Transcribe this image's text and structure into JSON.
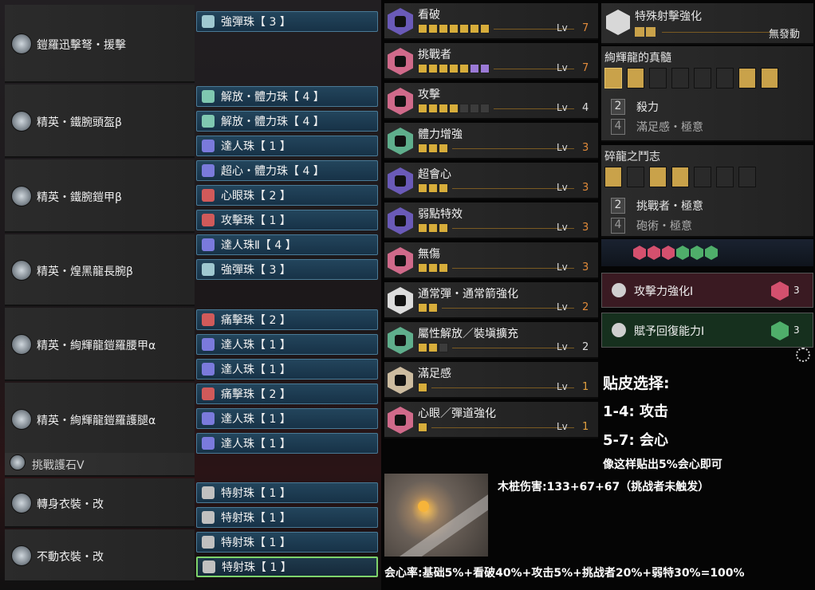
{
  "equipment": [
    {
      "name": "鎧羅迅擊弩・援擊",
      "decos": [
        "強彈珠【 3 】"
      ]
    },
    {
      "name": "精英・鐵腕頭盔β",
      "decos": [
        "解放・體力珠【 4 】",
        "解放・體力珠【 4 】",
        "達人珠【 1 】"
      ]
    },
    {
      "name": "精英・鐵腕鎧甲β",
      "decos": [
        "超心・體力珠【 4 】",
        "心眼珠【 2 】",
        "攻擊珠【 1 】"
      ]
    },
    {
      "name": "精英・煌黑龍長腕β",
      "decos": [
        "達人珠Ⅱ【 4 】",
        "強彈珠【 3 】"
      ]
    },
    {
      "name": "精英・絢輝龍鎧羅腰甲α",
      "decos": [
        "痛擊珠【 2 】",
        "達人珠【 1 】",
        "達人珠【 1 】"
      ]
    },
    {
      "name": "精英・絢輝龍鎧羅護腿α",
      "decos": [
        "痛擊珠【 2 】",
        "達人珠【 1 】",
        "達人珠【 1 】"
      ]
    },
    {
      "name": "挑戰護石Ⅴ",
      "decos": []
    },
    {
      "name": "轉身衣裝・改",
      "decos": [
        "特射珠【 1 】",
        "特射珠【 1 】"
      ]
    },
    {
      "name": "不動衣裝・改",
      "decos": [
        "特射珠【 1 】",
        "特射珠【 1 】"
      ]
    }
  ],
  "skills": [
    {
      "name": "看破",
      "lv_label": "Lv",
      "level": "7",
      "on": 7,
      "max": 7,
      "pur": 0,
      "color": "#6a5ab8"
    },
    {
      "name": "挑戰者",
      "lv_label": "Lv",
      "level": "7",
      "on": 5,
      "max": 7,
      "pur": 2,
      "color": "#d06a8a"
    },
    {
      "name": "攻擊",
      "lv_label": "Lv",
      "level": "4",
      "on": 4,
      "max": 7,
      "pur": 0,
      "color": "#d06a8a"
    },
    {
      "name": "體力增強",
      "lv_label": "Lv",
      "level": "3",
      "on": 3,
      "max": 3,
      "pur": 0,
      "color": "#5fae8c"
    },
    {
      "name": "超會心",
      "lv_label": "Lv",
      "level": "3",
      "on": 3,
      "max": 3,
      "pur": 0,
      "color": "#6a5ab8"
    },
    {
      "name": "弱點特效",
      "lv_label": "Lv",
      "level": "3",
      "on": 3,
      "max": 3,
      "pur": 0,
      "color": "#6a5ab8"
    },
    {
      "name": "無傷",
      "lv_label": "Lv",
      "level": "3",
      "on": 3,
      "max": 3,
      "pur": 0,
      "color": "#d06a8a"
    },
    {
      "name": "通常彈・通常箭強化",
      "lv_label": "Lv",
      "level": "2",
      "on": 2,
      "max": 2,
      "pur": 0,
      "color": "#dcdcdc"
    },
    {
      "name": "屬性解放／裝塡擴充",
      "lv_label": "Lv",
      "level": "2",
      "on": 2,
      "max": 3,
      "pur": 0,
      "color": "#5fae8c"
    },
    {
      "name": "滿足感",
      "lv_label": "Lv",
      "level": "1",
      "on": 1,
      "max": 1,
      "pur": 0,
      "color": "#cdbca0"
    },
    {
      "name": "心眼／彈道強化",
      "lv_label": "Lv",
      "level": "1",
      "on": 1,
      "max": 1,
      "pur": 0,
      "color": "#d06a8a"
    }
  ],
  "special": {
    "name": "特殊射擊強化",
    "status": "無發動"
  },
  "set1": {
    "name": "絢輝龍的真髓",
    "bonuses": [
      {
        "num": "2",
        "name": "殺力"
      },
      {
        "num": "4",
        "name": "滿足感・極意"
      }
    ]
  },
  "set2": {
    "name": "碎龍之鬥志",
    "bonuses": [
      {
        "num": "2",
        "name": "挑戰者・極意"
      },
      {
        "num": "4",
        "name": "砲術・極意"
      }
    ]
  },
  "kits": [
    {
      "name": "攻擊力強化Ⅰ",
      "count": "3",
      "color": "#d4506e",
      "bg": "#3a1a22"
    },
    {
      "name": "賦予回復能力Ⅰ",
      "count": "3",
      "color": "#4fae6a",
      "bg": "#16301e"
    }
  ],
  "notes": {
    "title": "贴皮选择:",
    "l1": "1-4: 攻击",
    "l2": "5-7: 会心",
    "l3": "像这样贴出5%会心即可",
    "damage": "木桩伤害:133+67+67（挑战者未触发）",
    "crit": "会心率:基础5%+看破40%+攻击5%+挑战者20%+弱特30%=100%"
  }
}
